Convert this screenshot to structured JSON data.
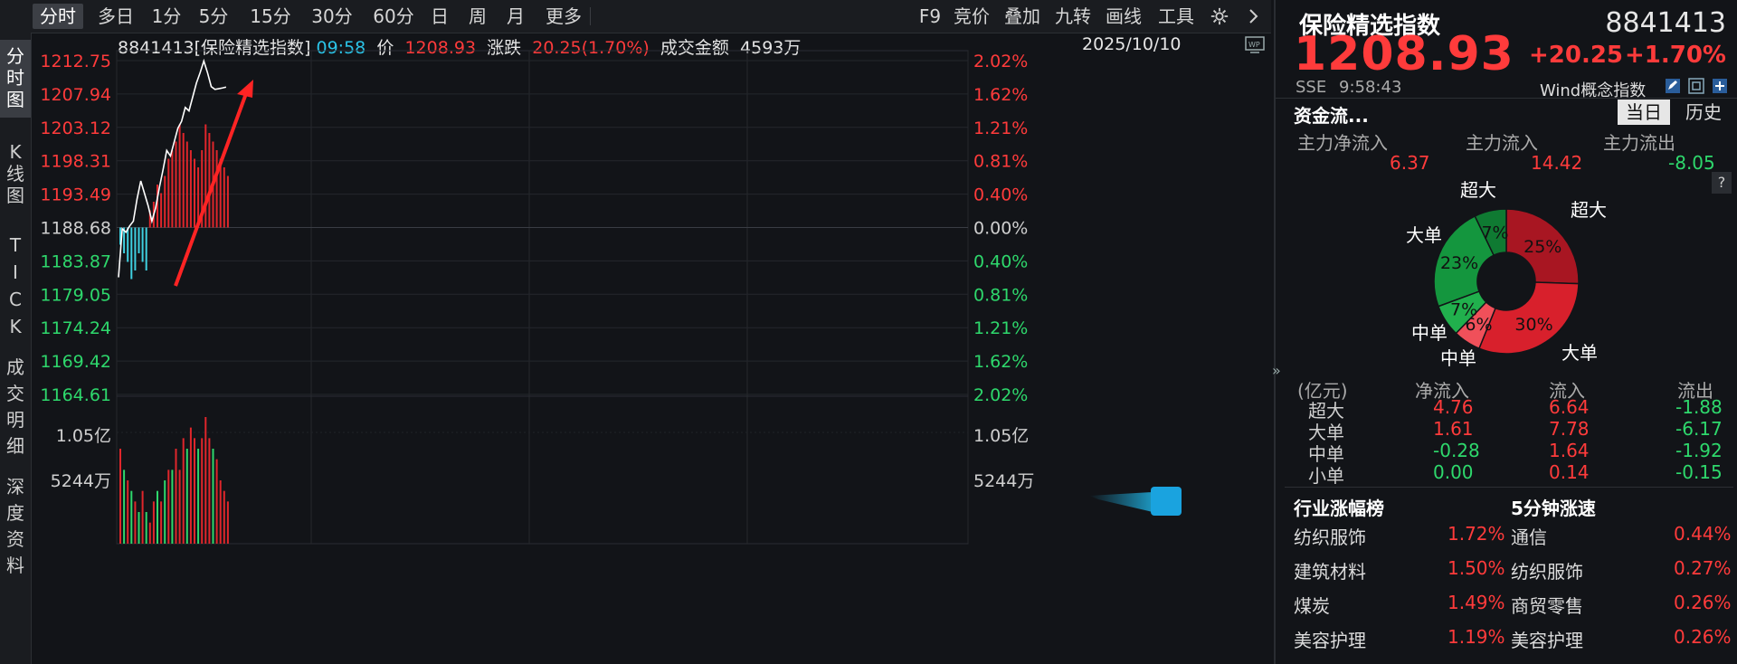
{
  "toolbar": {
    "tabs": [
      "分时",
      "多日",
      "1分",
      "5分",
      "15分",
      "30分",
      "60分",
      "日",
      "周",
      "月",
      "更多"
    ],
    "active": "分时",
    "right_items": [
      "F9",
      "竞价",
      "叠加",
      "九转",
      "画线",
      "工具"
    ],
    "settings_icon": "gear-icon",
    "collapse_icon": "chevron-right-icon"
  },
  "left_tabs": [
    {
      "label": "分时图",
      "active": true
    },
    {
      "label": "K线图",
      "active": false
    },
    {
      "label": "TICK",
      "active": false
    },
    {
      "label": "成交明细",
      "active": false
    },
    {
      "label": "深度资料",
      "active": false
    }
  ],
  "chart_header": {
    "code_name": "8841413[保险精选指数]",
    "time": "09:58",
    "price_label": "价",
    "price": "1208.93",
    "change_label": "涨跌",
    "change": "20.25(1.70%)",
    "volume_label": "成交金额",
    "volume": "4593万",
    "date": "2025/10/10"
  },
  "chart_data": {
    "type": "line",
    "title": "8841413[保险精选指数]",
    "y_ticks_left": [
      "1212.75",
      "1207.94",
      "1203.12",
      "1198.31",
      "1193.49",
      "1188.68",
      "1183.87",
      "1179.05",
      "1174.24",
      "1169.42",
      "1164.61"
    ],
    "y_ticks_right": [
      "2.02%",
      "1.62%",
      "1.21%",
      "0.81%",
      "0.40%",
      "0.00%",
      "0.40%",
      "0.81%",
      "1.21%",
      "1.62%",
      "2.02%"
    ],
    "ylim": [
      1164.61,
      1212.75
    ],
    "base": 1188.68,
    "series": [
      {
        "name": "价",
        "x": [
          1,
          2,
          3,
          4,
          5,
          6,
          7,
          8,
          9,
          10,
          11,
          12,
          13,
          14,
          15,
          16,
          17,
          18,
          19,
          20,
          21,
          22,
          23,
          24,
          25,
          26,
          27,
          28,
          29,
          30
        ],
        "values": [
          1181.5,
          1188.5,
          1188.0,
          1188.9,
          1189.6,
          1192.8,
          1195.4,
          1193.6,
          1191.8,
          1189.6,
          1191.5,
          1194.4,
          1197.0,
          1199.8,
          1199.0,
          1201.0,
          1203.0,
          1204.0,
          1206.0,
          1205.5,
          1207.5,
          1209.5,
          1211.0,
          1212.7,
          1211.0,
          1209.0,
          1208.6,
          1208.7,
          1208.8,
          1208.93
        ]
      }
    ],
    "volume_ticks": [
      "1.05亿",
      "5244万"
    ],
    "volume_bars": [
      9,
      7,
      6,
      5,
      4,
      3,
      5,
      3,
      2,
      4,
      5,
      4,
      6,
      7,
      7,
      9,
      7,
      10,
      9,
      11,
      10,
      9,
      10,
      12,
      10,
      9,
      8,
      6,
      5,
      4
    ],
    "volume_colors": [
      "r",
      "g",
      "r",
      "g",
      "r",
      "g",
      "r",
      "g",
      "r",
      "r",
      "g",
      "r",
      "g",
      "r",
      "g",
      "r",
      "r",
      "r",
      "g",
      "r",
      "r",
      "g",
      "r",
      "r",
      "r",
      "g",
      "r",
      "r",
      "r",
      "r"
    ],
    "macd_bars": [
      -2,
      -3,
      -4,
      -6,
      -5,
      -3,
      -4,
      -5,
      2,
      3,
      5,
      4,
      6,
      8,
      9,
      10,
      12,
      11,
      10,
      9,
      8,
      7,
      9,
      12,
      11,
      10,
      9,
      8,
      7,
      6
    ]
  },
  "quote": {
    "name": "保险精选指数",
    "code": "8841413",
    "price": "1208.93",
    "change": "+20.25",
    "pct": "+1.70%",
    "exchange": "SSE",
    "time": "9:58:43",
    "concept": "Wind概念指数"
  },
  "fund_flow": {
    "title": "资金流...",
    "tabs": [
      "当日",
      "历史"
    ],
    "active_tab": "当日",
    "summary_labels": [
      "主力净流入",
      "主力流入",
      "主力流出"
    ],
    "summary_values": [
      "6.37",
      "14.42",
      "-8.05"
    ],
    "help": "?",
    "donut": [
      {
        "label": "超大",
        "pct": "25%",
        "value": 25,
        "color": "#a81622",
        "label_pos": "超大"
      },
      {
        "label": "大单",
        "pct": "30%",
        "value": 30,
        "color": "#d8202c"
      },
      {
        "label": "中单",
        "pct": "6%",
        "value": 6,
        "color": "#f0505a"
      },
      {
        "label": "中单",
        "pct": "7%",
        "value": 7,
        "color": "#21b04d"
      },
      {
        "label": "大单",
        "pct": "23%",
        "value": 23,
        "color": "#14963e"
      },
      {
        "label": "超大",
        "pct": "7%",
        "value": 7,
        "color": "#0f7a32"
      }
    ],
    "donut_labels": {
      "top": "超大",
      "right_top": "超大",
      "left_top": "大单",
      "left_bottom": "中单",
      "bottom": "中单",
      "right_bottom": "大单"
    },
    "table_header": [
      "(亿元)",
      "净流入",
      "流入",
      "流出"
    ],
    "table_rows": [
      [
        "超大",
        "4.76",
        "6.64",
        "-1.88"
      ],
      [
        "大单",
        "1.61",
        "7.78",
        "-6.17"
      ],
      [
        "中单",
        "-0.28",
        "1.64",
        "-1.92"
      ],
      [
        "小单",
        "0.00",
        "0.14",
        "-0.15"
      ]
    ]
  },
  "rankings": {
    "left_title": "行业涨幅榜",
    "right_title": "5分钟涨速",
    "left": [
      [
        "纺织服饰",
        "1.72%"
      ],
      [
        "建筑材料",
        "1.50%"
      ],
      [
        "煤炭",
        "1.49%"
      ],
      [
        "美容护理",
        "1.19%"
      ]
    ],
    "right": [
      [
        "通信",
        "0.44%"
      ],
      [
        "纺织服饰",
        "0.27%"
      ],
      [
        "商贸零售",
        "0.26%"
      ],
      [
        "美容护理",
        "0.26%"
      ]
    ]
  },
  "colors": {
    "up": "#ff3b3b",
    "down": "#2ed86c",
    "bg": "#121418"
  }
}
